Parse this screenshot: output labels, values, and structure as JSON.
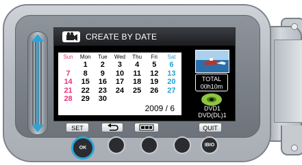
{
  "screen": {
    "title": "CREATE BY DATE"
  },
  "calendar": {
    "weekdays": [
      "Sun",
      "Mon",
      "Tue",
      "Wed",
      "Thu",
      "Fri",
      "Sat"
    ],
    "weeks": [
      [
        "",
        "1",
        "2",
        "3",
        "4",
        "5",
        "6"
      ],
      [
        "7",
        "8",
        "9",
        "10",
        "11",
        "12",
        "13"
      ],
      [
        "14",
        "15",
        "16",
        "17",
        "18",
        "19",
        "20"
      ],
      [
        "21",
        "22",
        "23",
        "24",
        "25",
        "26",
        "27"
      ],
      [
        "28",
        "29",
        "30",
        "",
        "",
        "",
        ""
      ]
    ],
    "month_label": "2009 / 6",
    "colors": {
      "sunday": "#e8327a",
      "saturday": "#1fa3d8"
    }
  },
  "info": {
    "total_label": "TOTAL",
    "total_time": "00h10m",
    "disc_line1": "DVD1",
    "disc_line2": "DVD(DL)1"
  },
  "softkeys": {
    "set": "SET",
    "back_icon": "return-arrow-icon",
    "check_icon": "check-toggle-icon",
    "quit": "QUIT"
  },
  "buttons": {
    "ok": "OK",
    "display": "IBIO"
  },
  "colors": {
    "highlight": "#2aa6d8"
  }
}
